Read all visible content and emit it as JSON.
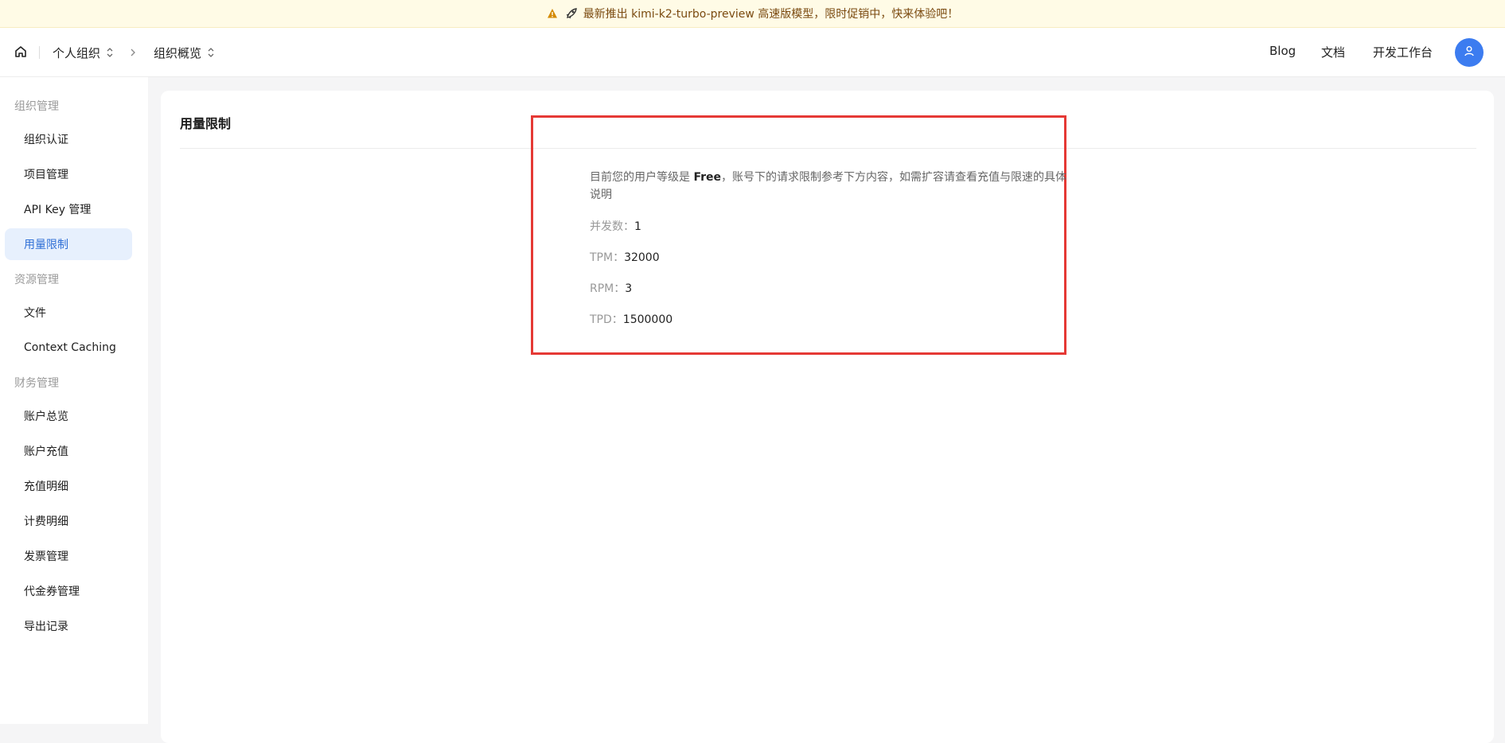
{
  "banner": {
    "text": "最新推出 kimi-k2-turbo-preview 高速版模型，限时促销中，快来体验吧！"
  },
  "header": {
    "org": "个人组织",
    "page": "组织概览",
    "links": [
      "Blog",
      "文档",
      "开发工作台"
    ]
  },
  "sidebar": {
    "groups": [
      {
        "title": "组织管理",
        "items": [
          "组织认证",
          "项目管理",
          "API Key 管理",
          "用量限制"
        ]
      },
      {
        "title": "资源管理",
        "items": [
          "文件",
          "Context Caching"
        ]
      },
      {
        "title": "财务管理",
        "items": [
          "账户总览",
          "账户充值",
          "充值明细",
          "计费明细",
          "发票管理",
          "代金券管理",
          "导出记录"
        ]
      }
    ],
    "active": "用量限制"
  },
  "main": {
    "title": "用量限制",
    "desc_prefix": "目前您的用户等级是 ",
    "tier": "Free",
    "desc_suffix": "，账号下的请求限制参考下方内容，如需扩容请查看充值与限速的具体说明",
    "limits": [
      {
        "label": "并发数：",
        "value": "1"
      },
      {
        "label": "TPM：",
        "value": "32000"
      },
      {
        "label": "RPM：",
        "value": "3"
      },
      {
        "label": "TPD：",
        "value": "1500000"
      }
    ]
  },
  "colors": {
    "accent": "#2f6fd6",
    "avatar": "#3c7cf0",
    "highlight": "#e53935",
    "banner_bg": "#fffbe6"
  },
  "icons": [
    "warning-icon",
    "rocket-icon",
    "home-icon",
    "updown-icon",
    "chevron-right-icon",
    "user-icon"
  ]
}
